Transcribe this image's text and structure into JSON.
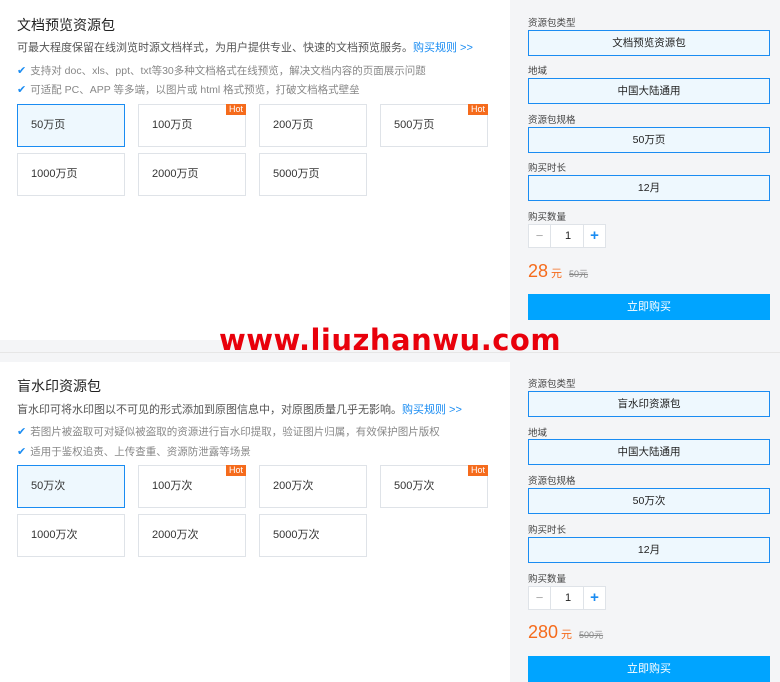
{
  "watermark": "www.liuzhanwu.com",
  "doc_preview": {
    "title": "文档预览资源包",
    "description": "可最大程度保留在线浏览时源文档样式，为用户提供专业、快速的文档预览服务。",
    "rules_link": "购买规则 >>",
    "features": [
      "支持对 doc、xls、ppt、txt等30多种文档格式在线预览，解决文档内容的页面展示问题",
      "可适配 PC、APP 等多端，以图片或 html 格式预览，打破文档格式壁垒"
    ],
    "options": [
      {
        "label": "50万页",
        "selected": true,
        "hot": ""
      },
      {
        "label": "100万页",
        "selected": false,
        "hot": "Hot"
      },
      {
        "label": "200万页",
        "selected": false,
        "hot": ""
      },
      {
        "label": "500万页",
        "selected": false,
        "hot": "Hot"
      },
      {
        "label": "1000万页",
        "selected": false,
        "hot": ""
      },
      {
        "label": "2000万页",
        "selected": false,
        "hot": ""
      },
      {
        "label": "5000万页",
        "selected": false,
        "hot": ""
      }
    ],
    "form": {
      "type_label": "资源包类型",
      "type_value": "文档预览资源包",
      "region_label": "地域",
      "region_value": "中国大陆通用",
      "spec_label": "资源包规格",
      "spec_value": "50万页",
      "duration_label": "购买时长",
      "duration_value": "12月",
      "quantity_label": "购买数量",
      "quantity": "1",
      "minus": "−",
      "plus": "+",
      "price": "28",
      "price_unit": "元",
      "original_price": "50元",
      "buy_label": "立即购买"
    }
  },
  "watermark_pkg": {
    "title": "盲水印资源包",
    "description": "盲水印可将水印图以不可见的形式添加到原图信息中，对原图质量几乎无影响。",
    "rules_link": "购买规则 >>",
    "features": [
      "若图片被盗取可对疑似被盗取的资源进行盲水印提取，验证图片归属，有效保护图片版权",
      "适用于鉴权追责、上传查重、资源防泄露等场景"
    ],
    "options": [
      {
        "label": "50万次",
        "selected": true,
        "hot": ""
      },
      {
        "label": "100万次",
        "selected": false,
        "hot": "Hot"
      },
      {
        "label": "200万次",
        "selected": false,
        "hot": ""
      },
      {
        "label": "500万次",
        "selected": false,
        "hot": "Hot"
      },
      {
        "label": "1000万次",
        "selected": false,
        "hot": ""
      },
      {
        "label": "2000万次",
        "selected": false,
        "hot": ""
      },
      {
        "label": "5000万次",
        "selected": false,
        "hot": ""
      }
    ],
    "form": {
      "type_label": "资源包类型",
      "type_value": "盲水印资源包",
      "region_label": "地域",
      "region_value": "中国大陆通用",
      "spec_label": "资源包规格",
      "spec_value": "50万次",
      "duration_label": "购买时长",
      "duration_value": "12月",
      "quantity_label": "购买数量",
      "quantity": "1",
      "minus": "−",
      "plus": "+",
      "price": "280",
      "price_unit": "元",
      "original_price": "500元",
      "buy_label": "立即购买"
    }
  },
  "icons": {
    "check": "✔"
  },
  "colors": {
    "accent": "#1a8cf2",
    "price": "#f56b1c",
    "buy_button": "#00a4ff",
    "hot_badge": "#f56b1c",
    "watermark": "#e8000b"
  }
}
